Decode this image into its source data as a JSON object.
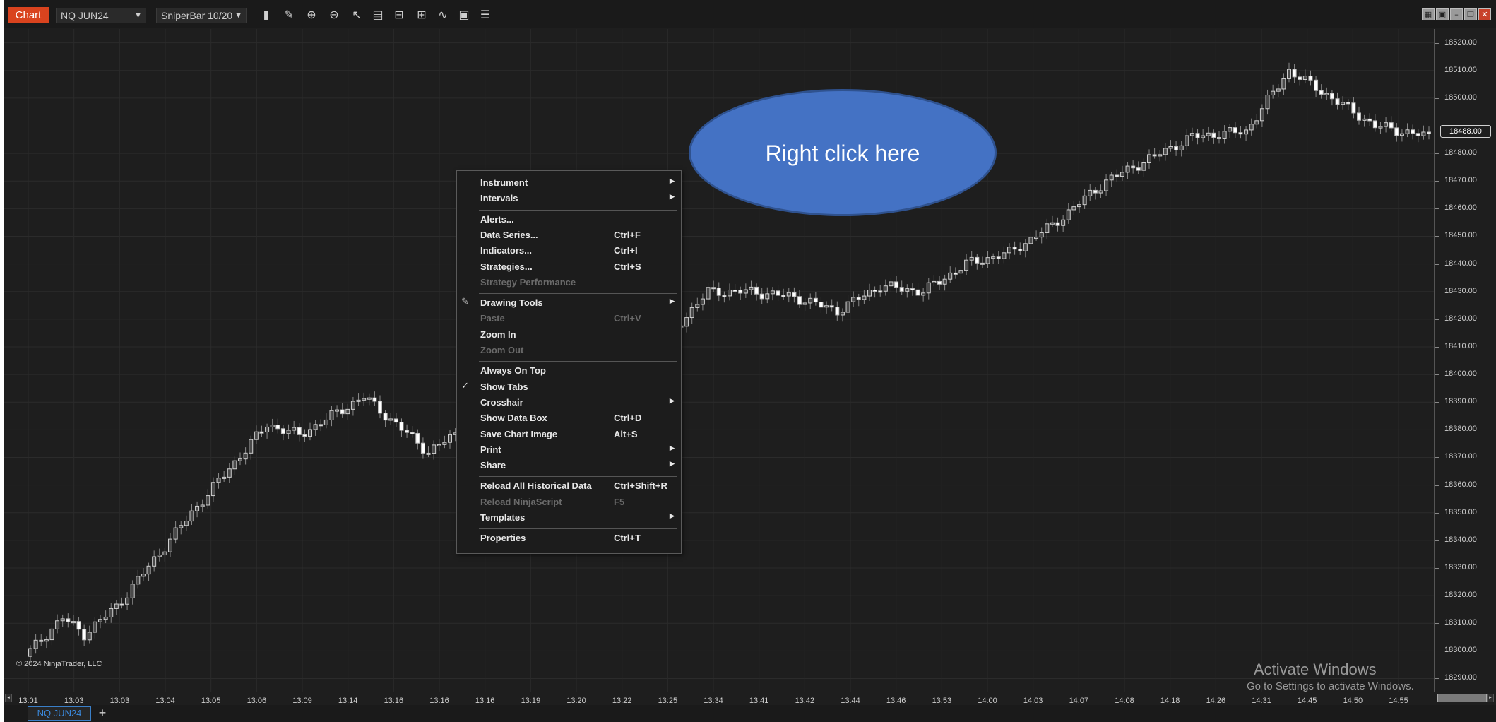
{
  "toolbar": {
    "window_label": "Chart",
    "instrument": "NQ JUN24",
    "interval": "SniperBar 10/20",
    "tool_icons": [
      "bar-style-icon",
      "pencil-icon",
      "zoom-in-icon",
      "zoom-out-icon",
      "pointer-icon",
      "data-box-icon",
      "chart-trader-icon",
      "strategy-icon",
      "indicator-icon",
      "properties-icon",
      "list-icon"
    ],
    "window_controls": [
      "tile-icon",
      "restore-icon",
      "minimize-icon",
      "maximize-icon",
      "close-icon"
    ]
  },
  "chart": {
    "copyright": "© 2024 NinjaTrader, LLC",
    "last_price": "18488.00",
    "price_ticks": [
      "18520.00",
      "18510.00",
      "18500.00",
      "18480.00",
      "18470.00",
      "18460.00",
      "18450.00",
      "18440.00",
      "18430.00",
      "18420.00",
      "18410.00",
      "18400.00",
      "18390.00",
      "18380.00",
      "18370.00",
      "18360.00",
      "18350.00",
      "18340.00",
      "18330.00",
      "18320.00",
      "18310.00",
      "18300.00",
      "18290.00"
    ],
    "time_ticks": [
      "13:01",
      "13:03",
      "13:03",
      "13:04",
      "13:05",
      "13:06",
      "13:09",
      "13:14",
      "13:16",
      "13:16",
      "13:16",
      "13:19",
      "13:20",
      "13:22",
      "13:25",
      "13:34",
      "13:41",
      "13:42",
      "13:44",
      "13:46",
      "13:53",
      "14:00",
      "14:03",
      "14:07",
      "14:08",
      "14:18",
      "14:26",
      "14:31",
      "14:45",
      "14:50",
      "14:55"
    ],
    "colors": {
      "background": "#1e1e1e",
      "up_bar": "#cfcfcf",
      "down_bar": "#ffffff",
      "grid": "#2b2b2b"
    }
  },
  "chart_data": {
    "type": "candlestick",
    "ylim": [
      18285,
      18525
    ],
    "x_labels": [
      "13:01",
      "13:03",
      "13:03",
      "13:04",
      "13:05",
      "13:06",
      "13:09",
      "13:14",
      "13:16",
      "13:16",
      "13:16",
      "13:19",
      "13:20",
      "13:22",
      "13:25",
      "13:34",
      "13:41",
      "13:42",
      "13:44",
      "13:46",
      "13:53",
      "14:00",
      "14:03",
      "14:07",
      "14:08",
      "14:18",
      "14:26",
      "14:31",
      "14:45",
      "14:50",
      "14:55"
    ],
    "close_path": [
      [
        0,
        18300
      ],
      [
        6,
        18312
      ],
      [
        10,
        18306
      ],
      [
        16,
        18316
      ],
      [
        30,
        18350
      ],
      [
        44,
        18382
      ],
      [
        50,
        18378
      ],
      [
        62,
        18392
      ],
      [
        74,
        18372
      ],
      [
        82,
        18382
      ],
      [
        88,
        18410
      ],
      [
        100,
        18422
      ],
      [
        106,
        18412
      ],
      [
        114,
        18404
      ],
      [
        126,
        18430
      ],
      [
        134,
        18430
      ],
      [
        142,
        18428
      ],
      [
        150,
        18423
      ],
      [
        158,
        18432
      ],
      [
        166,
        18430
      ],
      [
        174,
        18440
      ],
      [
        182,
        18444
      ],
      [
        190,
        18454
      ],
      [
        200,
        18470
      ],
      [
        216,
        18486
      ],
      [
        226,
        18488
      ],
      [
        234,
        18510
      ],
      [
        242,
        18500
      ],
      [
        250,
        18490
      ],
      [
        260,
        18486
      ]
    ]
  },
  "context_menu": {
    "items": [
      {
        "label": "Instrument",
        "sub": true
      },
      {
        "label": "Intervals",
        "sub": true
      },
      {
        "sep": true
      },
      {
        "label": "Alerts..."
      },
      {
        "label": "Data Series...",
        "shortcut": "Ctrl+F"
      },
      {
        "label": "Indicators...",
        "shortcut": "Ctrl+I"
      },
      {
        "label": "Strategies...",
        "shortcut": "Ctrl+S"
      },
      {
        "label": "Strategy Performance",
        "disabled": true
      },
      {
        "sep": true
      },
      {
        "label": "Drawing Tools",
        "sub": true,
        "icon": "pencil-icon"
      },
      {
        "label": "Paste",
        "shortcut": "Ctrl+V",
        "disabled": true
      },
      {
        "label": "Zoom In"
      },
      {
        "label": "Zoom Out",
        "disabled": true
      },
      {
        "sep": true
      },
      {
        "label": "Always On Top"
      },
      {
        "label": "Show Tabs",
        "checked": true
      },
      {
        "label": "Crosshair",
        "sub": true
      },
      {
        "label": "Show Data Box",
        "shortcut": "Ctrl+D"
      },
      {
        "label": "Save Chart Image",
        "shortcut": "Alt+S"
      },
      {
        "label": "Print",
        "sub": true
      },
      {
        "label": "Share",
        "sub": true
      },
      {
        "sep": true
      },
      {
        "label": "Reload All Historical Data",
        "shortcut": "Ctrl+Shift+R"
      },
      {
        "label": "Reload NinjaScript",
        "shortcut": "F5",
        "disabled": true
      },
      {
        "label": "Templates",
        "sub": true
      },
      {
        "sep": true
      },
      {
        "label": "Properties",
        "shortcut": "Ctrl+T"
      }
    ]
  },
  "callout": {
    "text": "Right click here",
    "color": "#4472c4"
  },
  "watermark": {
    "title": "Activate Windows",
    "subtitle": "Go to Settings to activate Windows."
  },
  "tabs": {
    "active": "NQ JUN24",
    "add": "+"
  }
}
